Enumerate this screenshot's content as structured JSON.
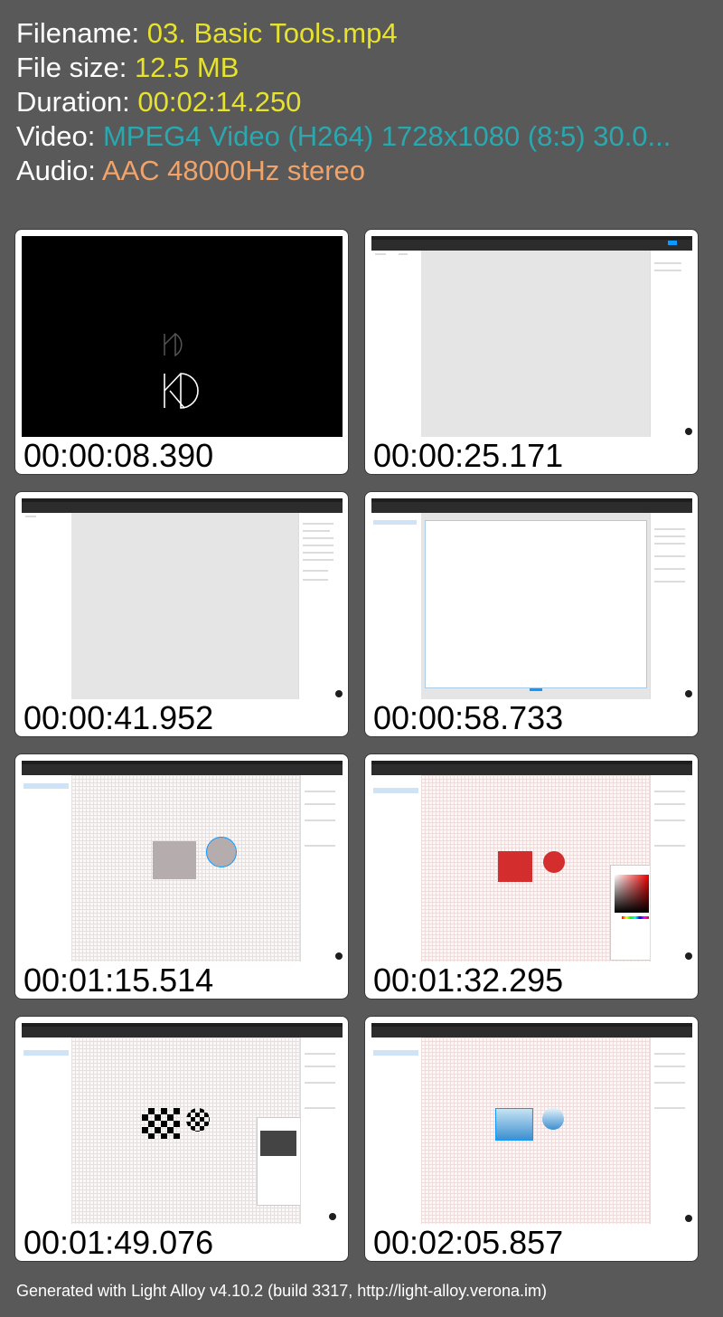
{
  "info": {
    "filename_label": "Filename:",
    "filename": "03. Basic Tools.mp4",
    "filesize_label": "File size:",
    "filesize": "12.5 MB",
    "duration_label": "Duration:",
    "duration": "00:02:14.250",
    "video_label": "Video:",
    "video": "MPEG4 Video (H264) 1728x1080 (8:5) 30.0...",
    "audio_label": "Audio:",
    "audio": "AAC 48000Hz stereo"
  },
  "thumbnails": [
    {
      "time": "00:00:08.390"
    },
    {
      "time": "00:00:25.171"
    },
    {
      "time": "00:00:41.952"
    },
    {
      "time": "00:00:58.733"
    },
    {
      "time": "00:01:15.514"
    },
    {
      "time": "00:01:32.295"
    },
    {
      "time": "00:01:49.076"
    },
    {
      "time": "00:02:05.857"
    }
  ],
  "footer": "Generated with Light Alloy v4.10.2 (build 3317, http://light-alloy.verona.im)"
}
